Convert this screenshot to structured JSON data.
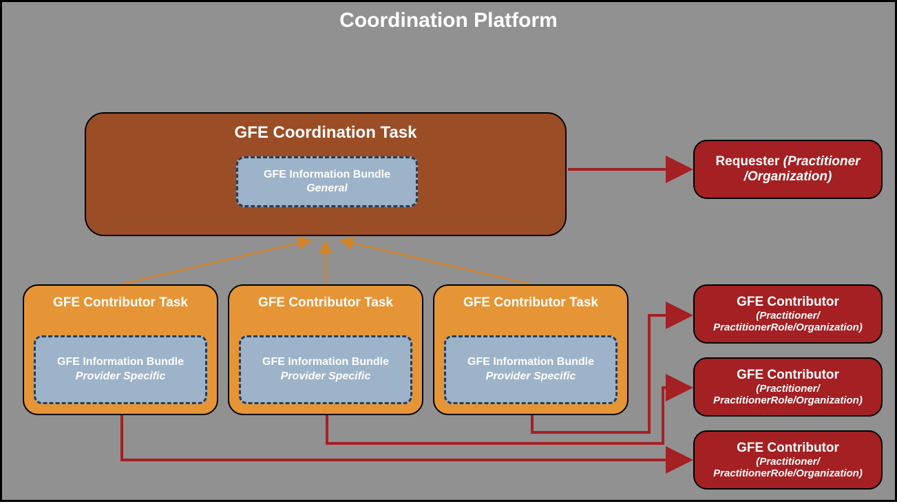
{
  "title": "Coordination Platform",
  "coord_task": {
    "title": "GFE Coordination Task",
    "bundle": {
      "title": "GFE Information Bundle",
      "subtitle": "General"
    }
  },
  "contrib_task": {
    "title": "GFE Contributor  Task",
    "bundle": {
      "title": "GFE Information Bundle",
      "subtitle": "Provider Specific"
    }
  },
  "requester": {
    "line": "Requester ",
    "sub": "(Practitioner /Organization)"
  },
  "contributor_box": {
    "title": "GFE Contributor",
    "sub1": "(Practitioner/",
    "sub2": "PractitionerRole/Organization)"
  },
  "colors": {
    "platform_bg": "#919191",
    "coord_task_bg": "#9b4e26",
    "contrib_task_bg": "#e59535",
    "bundle_bg": "#9db3c9",
    "red_box_bg": "#a42023",
    "arrow_orange": "#d38427",
    "arrow_red": "#a42023"
  }
}
